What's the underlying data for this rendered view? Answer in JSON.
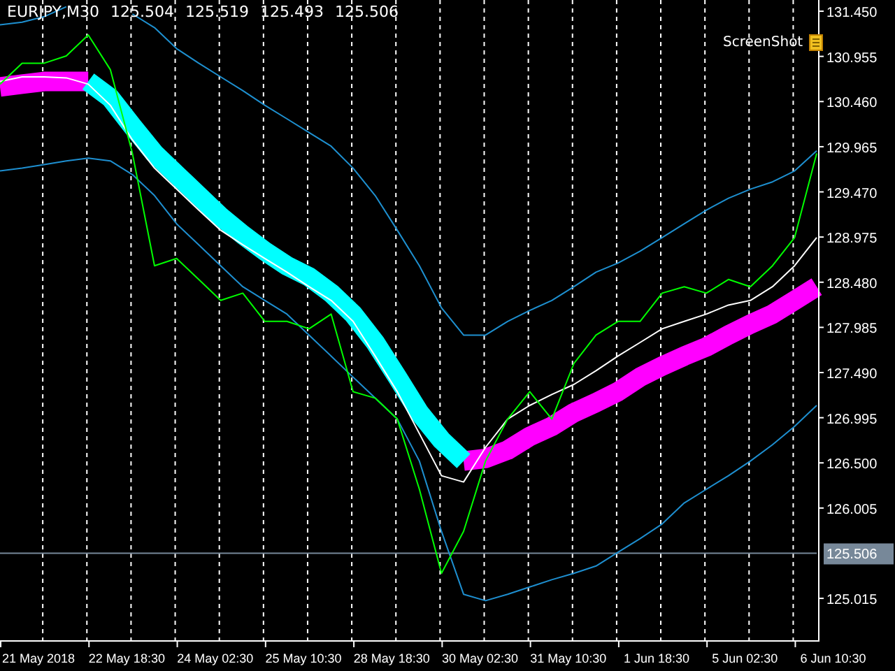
{
  "header": {
    "symbol": "EURJPY,M30",
    "ohlc": [
      "125.504",
      "125.519",
      "125.493",
      "125.506"
    ]
  },
  "screenshot_button": {
    "label": "ScreenShot"
  },
  "current_price": {
    "label": "125.506"
  },
  "chart_data": {
    "type": "line",
    "grid": true,
    "categories": [
      null,
      null,
      "21 May 2018",
      null,
      null,
      null,
      "22 May 18:30",
      null,
      null,
      null,
      "24 May 02:30",
      null,
      null,
      null,
      "25 May 10:30",
      null,
      null,
      null,
      "28 May 18:30",
      null,
      null,
      null,
      "30 May 02:30",
      null,
      null,
      null,
      "31 May 10:30",
      null,
      null,
      null,
      "1 Jun 18:30",
      null,
      null,
      null,
      "5 Jun 02:30",
      null,
      null,
      null,
      "6 Jun 10:30"
    ],
    "ylim": [
      124.556,
      131.573
    ],
    "yticks": [
      {
        "value": 131.45,
        "label": "131.450"
      },
      {
        "value": 130.955,
        "label": "130.955"
      },
      {
        "value": 130.46,
        "label": "130.460"
      },
      {
        "value": 129.965,
        "label": "129.965"
      },
      {
        "value": 129.47,
        "label": "129.470"
      },
      {
        "value": 128.975,
        "label": "128.975"
      },
      {
        "value": 128.48,
        "label": "128.480"
      },
      {
        "value": 127.985,
        "label": "127.985"
      },
      {
        "value": 127.49,
        "label": "127.490"
      },
      {
        "value": 126.995,
        "label": "126.995"
      },
      {
        "value": 126.5,
        "label": "126.500"
      },
      {
        "value": 126.005,
        "label": "126.005"
      },
      {
        "value": 125.015,
        "label": "125.015"
      }
    ],
    "series": [
      {
        "color": "#778899",
        "values": [
          125.51,
          125.51,
          125.51,
          125.51,
          125.51,
          125.51,
          125.51,
          125.51,
          125.51,
          125.51,
          125.51,
          125.51,
          125.51,
          125.51,
          125.51,
          125.51,
          125.51,
          125.51,
          125.51,
          125.51,
          125.51,
          125.51,
          125.51,
          125.51,
          125.51,
          125.51,
          125.51,
          125.51,
          125.51,
          125.51,
          125.51,
          125.51,
          125.51,
          125.51,
          125.51,
          125.51,
          125.51,
          125.51,
          null
        ]
      },
      {
        "color": "#1e90d0",
        "values": [
          131.3,
          131.33,
          131.39,
          131.5,
          null,
          null,
          131.42,
          131.27,
          131.04,
          130.88,
          130.73,
          130.58,
          130.42,
          130.27,
          130.12,
          129.97,
          129.73,
          129.43,
          129.05,
          128.66,
          128.2,
          127.9,
          127.9,
          128.05,
          128.17,
          128.28,
          128.43,
          128.59,
          128.69,
          128.82,
          128.97,
          129.12,
          129.27,
          129.4,
          129.5,
          129.58,
          129.7,
          129.92,
          null
        ]
      },
      {
        "color": "#1e8fd0",
        "values": [
          129.7,
          129.73,
          129.77,
          129.81,
          129.84,
          129.81,
          129.66,
          129.43,
          129.12,
          128.89,
          128.66,
          128.43,
          128.28,
          128.13,
          127.9,
          127.67,
          127.44,
          127.21,
          126.98,
          126.52,
          125.75,
          125.06,
          124.99,
          125.06,
          125.14,
          125.22,
          125.29,
          125.37,
          125.52,
          125.67,
          125.83,
          126.06,
          126.21,
          126.36,
          126.52,
          126.7,
          126.9,
          127.13,
          null
        ]
      },
      {
        "color": "#ff00ff",
        "values": [
          130.62,
          130.65,
          130.68,
          130.68,
          130.68,
          null,
          null,
          null,
          null,
          null,
          null,
          null,
          null,
          null,
          null,
          null,
          null,
          null,
          null,
          null,
          null,
          126.52,
          126.55,
          126.64,
          126.79,
          126.9,
          127.05,
          127.16,
          127.28,
          127.44,
          127.56,
          127.67,
          127.77,
          127.9,
          128.02,
          128.13,
          128.28,
          128.43,
          null
        ]
      },
      {
        "color": "#00ffff",
        "values": [
          null,
          null,
          null,
          null,
          130.68,
          130.5,
          130.19,
          129.89,
          129.66,
          129.43,
          129.2,
          129.0,
          128.82,
          128.66,
          128.54,
          128.36,
          128.13,
          127.82,
          127.44,
          127.05,
          126.75,
          126.52,
          null,
          null,
          null,
          null,
          null,
          null,
          null,
          null,
          null,
          null,
          null,
          null,
          null,
          null,
          null,
          null,
          null
        ]
      },
      {
        "color": "#ffffff",
        "values": [
          130.68,
          130.73,
          130.73,
          130.72,
          130.65,
          130.42,
          130.04,
          129.73,
          129.5,
          129.27,
          129.05,
          128.89,
          128.74,
          128.59,
          128.43,
          128.28,
          128.05,
          127.67,
          127.28,
          126.82,
          126.36,
          126.29,
          126.67,
          126.98,
          127.13,
          127.25,
          127.36,
          127.51,
          127.67,
          127.82,
          127.97,
          128.05,
          128.13,
          128.23,
          128.28,
          128.43,
          128.66,
          128.97,
          null
        ]
      },
      {
        "color": "#00ff00",
        "values": [
          130.65,
          130.88,
          130.88,
          130.96,
          131.19,
          130.81,
          129.89,
          128.66,
          128.74,
          128.51,
          128.28,
          128.36,
          128.05,
          128.05,
          127.97,
          128.13,
          127.28,
          127.21,
          126.98,
          126.21,
          125.29,
          125.75,
          126.52,
          126.98,
          127.28,
          126.98,
          127.59,
          127.9,
          128.05,
          128.05,
          128.36,
          128.43,
          128.36,
          128.51,
          128.43,
          128.66,
          128.97,
          129.89,
          null
        ]
      }
    ]
  }
}
